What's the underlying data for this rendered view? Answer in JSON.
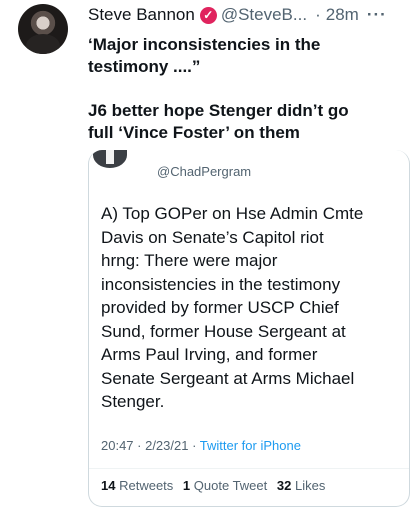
{
  "tweet": {
    "author_name": "Steve Bannon",
    "author_handle": "@SteveB...",
    "separator": "·",
    "time": "28m",
    "more": "···",
    "text_line1": "‘Major inconsistencies in the",
    "text_line2": "testimony ....”",
    "text_line3": "J6 better hope Stenger didn’t go",
    "text_line4": "full ‘Vince Foster’ on them",
    "verified_icon_color": "#e0245e"
  },
  "quoted": {
    "handle": "@ChadPergram",
    "text_lines": [
      "A) Top GOPer on Hse Admin Cmte",
      "Davis on Senate’s Capitol riot",
      "hrng: There were major",
      "inconsistencies in the testimony",
      "provided by former USCP Chief",
      "Sund, former House Sergeant at",
      "Arms Paul Irving, and former",
      "Senate Sergeant at Arms Michael",
      "Stenger."
    ],
    "timestamp": "20:47 · 2/23/21 · ",
    "source": "Twitter for iPhone",
    "retweets_count": "14",
    "retweets_label": "Retweets",
    "quotes_count": "1",
    "quotes_label": "Quote Tweet",
    "likes_count": "32",
    "likes_label": "Likes"
  }
}
